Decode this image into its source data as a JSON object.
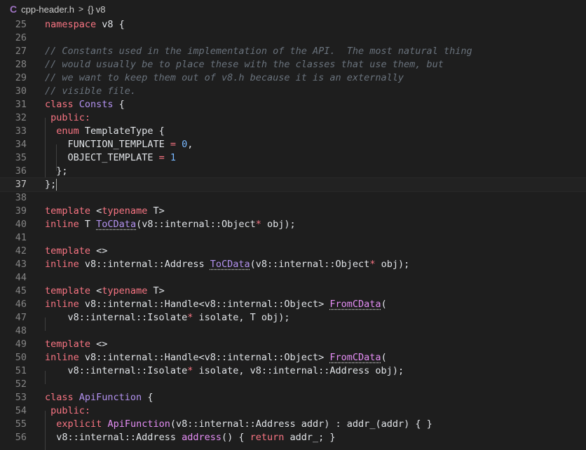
{
  "breadcrumb": {
    "file_icon_glyph": "C",
    "file_name": "cpp-header.h",
    "separator": ">",
    "symbol_icon_glyph": "{}",
    "symbol_name": "v8"
  },
  "editor": {
    "language": "cpp",
    "current_line": 37,
    "lines": [
      {
        "n": "25"
      },
      {
        "n": "26"
      },
      {
        "n": "27"
      },
      {
        "n": "28"
      },
      {
        "n": "29"
      },
      {
        "n": "30"
      },
      {
        "n": "31"
      },
      {
        "n": "32"
      },
      {
        "n": "33"
      },
      {
        "n": "34"
      },
      {
        "n": "35"
      },
      {
        "n": "36"
      },
      {
        "n": "37"
      },
      {
        "n": "38"
      },
      {
        "n": "39"
      },
      {
        "n": "40"
      },
      {
        "n": "41"
      },
      {
        "n": "42"
      },
      {
        "n": "43"
      },
      {
        "n": "44"
      },
      {
        "n": "45"
      },
      {
        "n": "46"
      },
      {
        "n": "47"
      },
      {
        "n": "48"
      },
      {
        "n": "49"
      },
      {
        "n": "50"
      },
      {
        "n": "51"
      },
      {
        "n": "52"
      },
      {
        "n": "53"
      },
      {
        "n": "54"
      },
      {
        "n": "55"
      },
      {
        "n": "56"
      }
    ],
    "tokens": {
      "l25_ns": "namespace",
      "l25_rest": " v8 {",
      "l27": "// Constants used in the implementation of the API.  The most natural thing",
      "l28": "// would usually be to place these with the classes that use them, but",
      "l29": "// we want to keep them out of v8.h because it is an externally",
      "l30": "// visible file.",
      "l31_kw": "class",
      "l31_name": " Consts",
      "l31_rest": " {",
      "l32_kw": "public:",
      "l33_kw": "enum",
      "l33_rest": " TemplateType {",
      "l34_id": "FUNCTION_TEMPLATE",
      "l34_eq": " = ",
      "l34_num": "0",
      "l34_end": ",",
      "l35_id": "OBJECT_TEMPLATE",
      "l35_eq": " = ",
      "l35_num": "1",
      "l36": "};",
      "l37": "};",
      "l39_kw": "template",
      "l39_a": " <",
      "l39_kw2": "typename",
      "l39_b": " T>",
      "l40_kw": "inline",
      "l40_a": " T ",
      "l40_fn": "ToCData",
      "l40_b": "(v8::internal::Object",
      "l40_star": "*",
      "l40_c": " obj);",
      "l42_kw": "template",
      "l42_a": " <>",
      "l43_kw": "inline",
      "l43_a": " v8::internal::Address ",
      "l43_fn": "ToCData",
      "l43_b": "(v8::internal::Object",
      "l43_star": "*",
      "l43_c": " obj);",
      "l45_kw": "template",
      "l45_a": " <",
      "l45_kw2": "typename",
      "l45_b": " T>",
      "l46_kw": "inline",
      "l46_a": " v8::internal::Handle<v8::internal::Object> ",
      "l46_fn": "FromCData",
      "l46_b": "(",
      "l47_a": "v8::internal::Isolate",
      "l47_star": "*",
      "l47_b": " isolate, T obj);",
      "l49_kw": "template",
      "l49_a": " <>",
      "l50_kw": "inline",
      "l50_a": " v8::internal::Handle<v8::internal::Object> ",
      "l50_fn": "FromCData",
      "l50_b": "(",
      "l51_a": "v8::internal::Isolate",
      "l51_star": "*",
      "l51_b": " isolate, v8::internal::Address obj);",
      "l53_kw": "class",
      "l53_name": " ApiFunction",
      "l53_rest": " {",
      "l54_kw": "public:",
      "l55_kw": "explicit",
      "l55_sp": " ",
      "l55_fn": "ApiFunction",
      "l55_rest": "(v8::internal::Address addr) : addr_(addr) { }",
      "l56_a": "v8::internal::Address ",
      "l56_fn": "address",
      "l56_b": "() { ",
      "l56_kw": "return",
      "l56_c": " addr_; }"
    }
  },
  "colors": {
    "background": "#1e1e1e",
    "keyword": "#f97583",
    "comment": "#6a737d",
    "number": "#79b8ff",
    "function": "#b392f0",
    "line_number": "#858585",
    "file_icon": "#a074c4"
  }
}
